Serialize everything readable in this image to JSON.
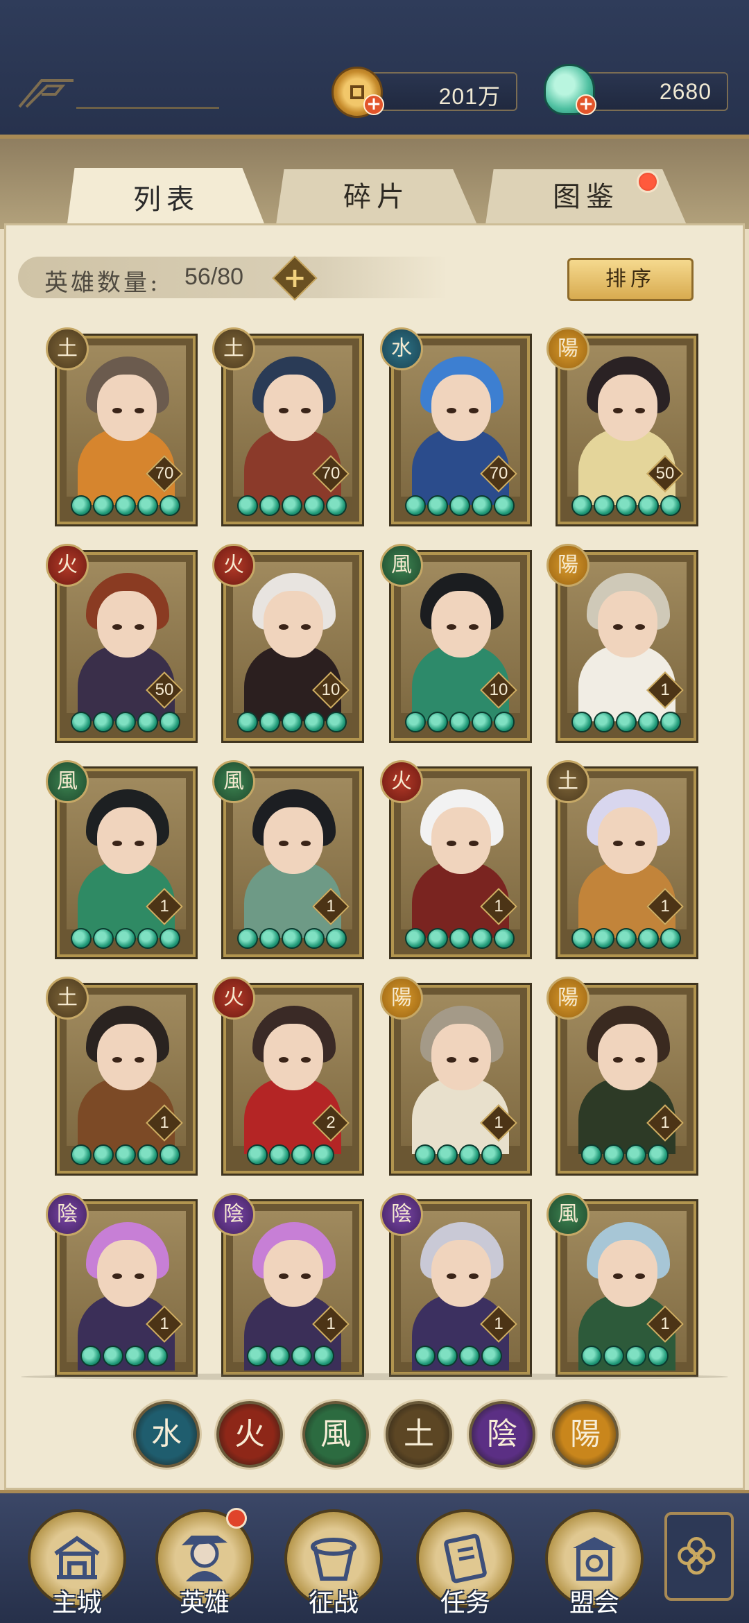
{
  "currency": {
    "coins": "201万",
    "jade": "2680"
  },
  "tabs": [
    {
      "label": "列表",
      "active": true
    },
    {
      "label": "碎片",
      "active": false
    },
    {
      "label": "图鉴",
      "active": false,
      "notification": true
    }
  ],
  "hero_count": {
    "label": "英雄数量:",
    "value": "56/80"
  },
  "sort_label": "排序",
  "colors": {
    "navy": "#2f3c5a",
    "gold": "#b2954f",
    "jade": "#1f9877",
    "parchment": "#f0e8d2"
  },
  "heroes": [
    {
      "element": "土",
      "level": "70",
      "stars": 5,
      "hair": "#6b5b4e",
      "outfit": "#d6852e"
    },
    {
      "element": "土",
      "level": "70",
      "stars": 5,
      "hair": "#2a3b56",
      "outfit": "#8b3a2a"
    },
    {
      "element": "水",
      "level": "70",
      "stars": 5,
      "hair": "#3d7fd1",
      "outfit": "#2b4c8c"
    },
    {
      "element": "陽",
      "level": "50",
      "stars": 5,
      "hair": "#2a2224",
      "outfit": "#e4d59a"
    },
    {
      "element": "火",
      "level": "50",
      "stars": 5,
      "hair": "#8a3b22",
      "outfit": "#3a2f4a"
    },
    {
      "element": "火",
      "level": "10",
      "stars": 5,
      "hair": "#e8e4e0",
      "outfit": "#2b1f1f"
    },
    {
      "element": "風",
      "level": "10",
      "stars": 5,
      "hair": "#1b1d20",
      "outfit": "#2d8a6a"
    },
    {
      "element": "陽",
      "level": "1",
      "stars": 5,
      "hair": "#cfc9b8",
      "outfit": "#f1ede4"
    },
    {
      "element": "風",
      "level": "1",
      "stars": 5,
      "hair": "#1d2022",
      "outfit": "#2f8a64"
    },
    {
      "element": "風",
      "level": "1",
      "stars": 5,
      "hair": "#1c1e22",
      "outfit": "#6e9a86"
    },
    {
      "element": "火",
      "level": "1",
      "stars": 5,
      "hair": "#f2f2f2",
      "outfit": "#7a2420"
    },
    {
      "element": "土",
      "level": "1",
      "stars": 5,
      "hair": "#d8d6ee",
      "outfit": "#c2843a"
    },
    {
      "element": "土",
      "level": "1",
      "stars": 5,
      "hair": "#2a2320",
      "outfit": "#7c4a26"
    },
    {
      "element": "火",
      "level": "2",
      "stars": 4,
      "hair": "#3a2a26",
      "outfit": "#b42525"
    },
    {
      "element": "陽",
      "level": "1",
      "stars": 4,
      "hair": "#a49a88",
      "outfit": "#e8e0cc"
    },
    {
      "element": "陽",
      "level": "1",
      "stars": 4,
      "hair": "#3a2a20",
      "outfit": "#2d3a26"
    },
    {
      "element": "陰",
      "level": "1",
      "stars": 4,
      "hair": "#c77fd6",
      "outfit": "#3b2f58"
    },
    {
      "element": "陰",
      "level": "1",
      "stars": 4,
      "hair": "#c77fd6",
      "outfit": "#3b2f58"
    },
    {
      "element": "陰",
      "level": "1",
      "stars": 4,
      "hair": "#c9c9d6",
      "outfit": "#3c3060"
    },
    {
      "element": "風",
      "level": "1",
      "stars": 4,
      "hair": "#a7c6d6",
      "outfit": "#2d5a3a"
    }
  ],
  "element_filters": [
    {
      "glyph": "水",
      "color": "#1f5d6e"
    },
    {
      "glyph": "火",
      "color": "#8e2718"
    },
    {
      "glyph": "風",
      "color": "#2c6b40"
    },
    {
      "glyph": "土",
      "color": "#5c4624"
    },
    {
      "glyph": "陰",
      "color": "#5b2f84"
    },
    {
      "glyph": "陽",
      "color": "#c9861c"
    }
  ],
  "bottom_nav": [
    {
      "label": "主城",
      "icon": "city-gate-icon"
    },
    {
      "label": "英雄",
      "icon": "hero-portrait-icon",
      "active": true,
      "notification": true
    },
    {
      "label": "征战",
      "icon": "war-drum-icon"
    },
    {
      "label": "任务",
      "icon": "scroll-task-icon"
    },
    {
      "label": "盟会",
      "icon": "alliance-pavilion-icon"
    }
  ]
}
